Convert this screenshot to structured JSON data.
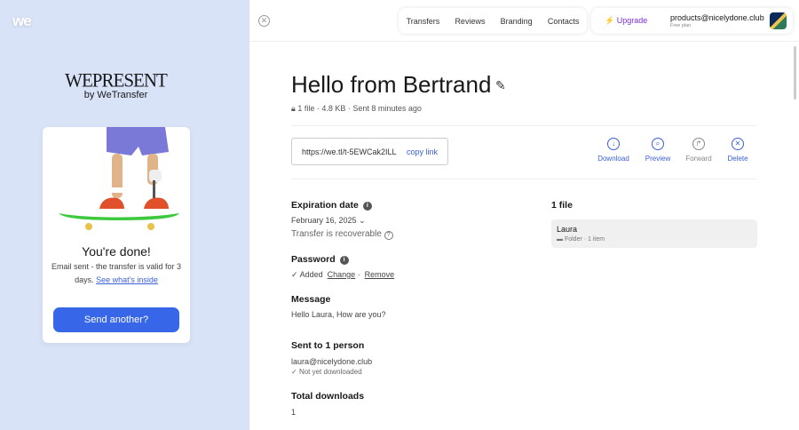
{
  "left": {
    "logo": "we",
    "brand": "WEPRESENT",
    "brand_sub": "by WeTransfer",
    "done_title": "You're done!",
    "done_msg": "Email sent - the transfer is valid for 3 days.",
    "done_link": "See what's inside",
    "send_another": "Send another?"
  },
  "nav": [
    "Transfers",
    "Reviews",
    "Branding",
    "Contacts"
  ],
  "account": {
    "upgrade": "Upgrade",
    "email": "products@nicelydone.club",
    "plan": "Free plan"
  },
  "transfer": {
    "title": "Hello from Bertrand",
    "files": "1 file",
    "size": "4.8 KB",
    "sent": "Sent 8 minutes ago",
    "url": "https://we.tl/t-5EWCak2ILL",
    "copy": "copy link",
    "actions": [
      {
        "label": "Download",
        "icon": "download-icon"
      },
      {
        "label": "Preview",
        "icon": "preview-icon"
      },
      {
        "label": "Forward",
        "icon": "forward-icon"
      },
      {
        "label": "Delete",
        "icon": "delete-icon"
      }
    ],
    "expiration_h": "Expiration date",
    "expiration": "February 16, 2025",
    "recoverable": "Transfer is recoverable",
    "password_h": "Password",
    "password_status": "Added",
    "change": "Change",
    "remove": "Remove",
    "message_h": "Message",
    "message": "Hello Laura, How are you?",
    "sent_h": "Sent to 1 person",
    "recipient": "laura@nicelydone.club",
    "recipient_status": "Not yet downloaded",
    "downloads_h": "Total downloads",
    "downloads": "1",
    "files_h": "1 file",
    "file_name": "Laura",
    "file_type": "Folder",
    "file_items": "1 item"
  }
}
